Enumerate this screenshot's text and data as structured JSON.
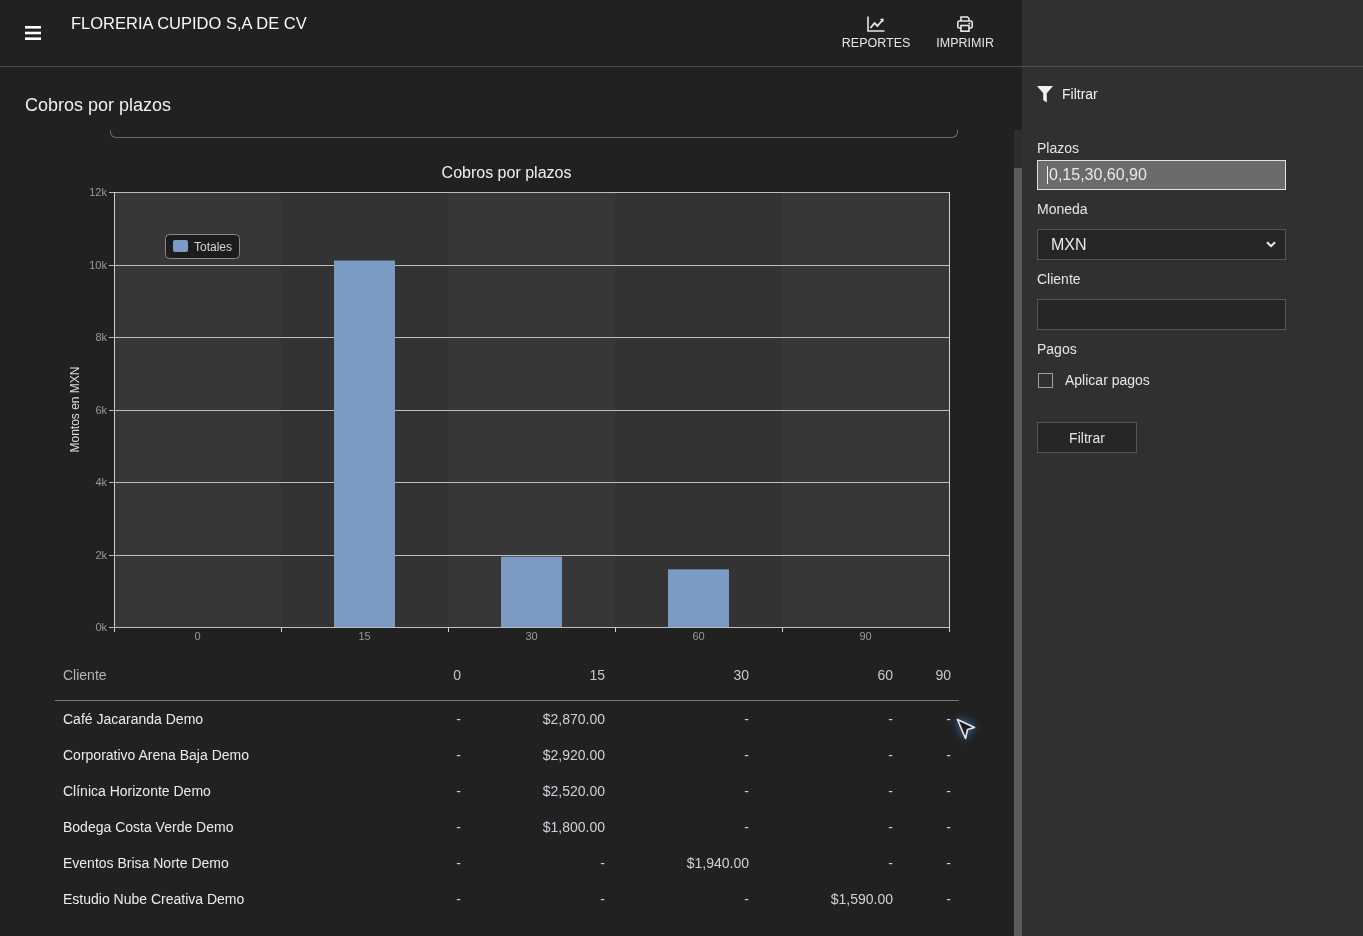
{
  "header": {
    "title": "FLORERIA CUPIDO S,A DE CV",
    "actions": [
      {
        "kind": "reports",
        "label": "REPORTES"
      },
      {
        "kind": "print",
        "label": "IMPRIMIR"
      }
    ]
  },
  "page": {
    "title": "Cobros por plazos"
  },
  "chart": {
    "chart_data": {
      "type": "bar",
      "title": "Cobros por plazos",
      "ylabel": "Montos en MXN",
      "categories": [
        "0",
        "15",
        "30",
        "60",
        "90"
      ],
      "series": [
        {
          "name": "Totales",
          "color": "#7a9cc4",
          "values": [
            0,
            10110,
            1940,
            1590,
            0
          ]
        }
      ],
      "ylim": [
        0,
        12000
      ],
      "yticks": [
        {
          "value": 0,
          "label": "0k"
        },
        {
          "value": 2000,
          "label": "2k"
        },
        {
          "value": 4000,
          "label": "4k"
        },
        {
          "value": 6000,
          "label": "6k"
        },
        {
          "value": 8000,
          "label": "8k"
        },
        {
          "value": 10000,
          "label": "10k"
        },
        {
          "value": 12000,
          "label": "12k"
        }
      ],
      "grid": true
    }
  },
  "table": {
    "columns": [
      "Cliente",
      "0",
      "15",
      "30",
      "60",
      "90"
    ],
    "rows": [
      [
        "Café Jacaranda Demo",
        "-",
        "$2,870.00",
        "-",
        "-",
        "-"
      ],
      [
        "Corporativo Arena Baja Demo",
        "-",
        "$2,920.00",
        "-",
        "-",
        "-"
      ],
      [
        "Clínica Horizonte Demo",
        "-",
        "$2,520.00",
        "-",
        "-",
        "-"
      ],
      [
        "Bodega Costa Verde Demo",
        "-",
        "$1,800.00",
        "-",
        "-",
        "-"
      ],
      [
        "Eventos Brisa Norte Demo",
        "-",
        "-",
        "$1,940.00",
        "-",
        "-"
      ],
      [
        "Estudio Nube Creativa Demo",
        "-",
        "-",
        "-",
        "$1,590.00",
        "-"
      ]
    ]
  },
  "filter_panel": {
    "title": "Filtrar",
    "fields": [
      {
        "kind": "text",
        "label": "Plazos",
        "value": "0,15,30,60,90",
        "focused": true
      },
      {
        "kind": "select",
        "label": "Moneda",
        "value": "MXN",
        "focused": false
      },
      {
        "kind": "text",
        "label": "Cliente",
        "focused": false
      }
    ],
    "payments": {
      "label": "Pagos",
      "option": "Aplicar pagos",
      "checked": false
    },
    "button": "Filtrar"
  }
}
